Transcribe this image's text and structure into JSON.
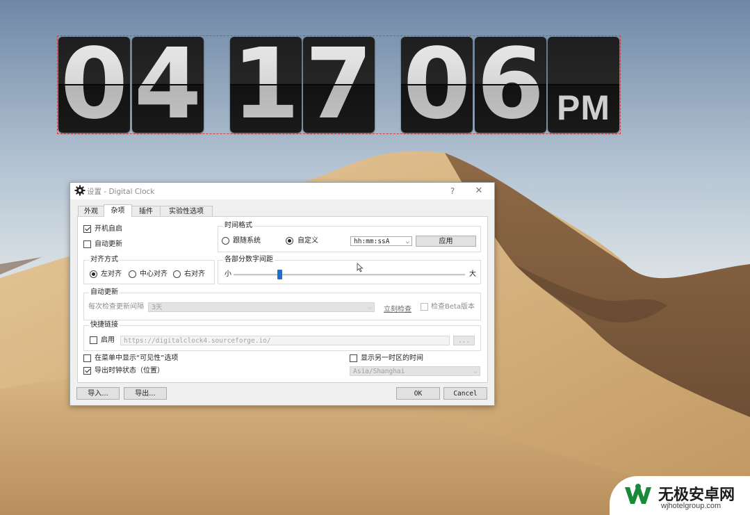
{
  "clock": {
    "digits": [
      "0",
      "4",
      "1",
      "7",
      "0",
      "6"
    ],
    "ampm": "PM"
  },
  "dialog": {
    "title": "设置 - Digital Clock",
    "help": "?",
    "close": "✕",
    "tabs": [
      "外观",
      "杂项",
      "插件",
      "实验性选项"
    ],
    "active_tab": "杂项",
    "autostart": {
      "label": "开机自启",
      "checked": true
    },
    "autoupdate_cb": {
      "label": "自动更新",
      "checked": false
    },
    "time_format": {
      "group": "时间格式",
      "system_label": "跟随系统",
      "custom_label": "自定义",
      "selected": "自定义",
      "format_value": "hh:mm:ssA",
      "apply_label": "应用"
    },
    "alignment": {
      "group": "对齐方式",
      "options": [
        "左对齐",
        "中心对齐",
        "右对齐"
      ],
      "selected": "左对齐"
    },
    "spacing": {
      "group": "各部分数字间距",
      "min_label": "小",
      "max_label": "大",
      "value_fraction": 0.2
    },
    "update": {
      "group": "自动更新",
      "interval_label": "每次检查更新间隔",
      "interval_value": "3天",
      "check_now_label": "立刻检查",
      "beta_label": "检查Beta版本",
      "beta_checked": false
    },
    "shortcut": {
      "group": "快捷链接",
      "enable_label": "启用",
      "enable_checked": false,
      "url": "https://digitalclock4.sourceforge.io/",
      "browse_label": "..."
    },
    "show_visibility": {
      "label": "在菜单中显示“可见性”选项",
      "checked": false
    },
    "export_state": {
      "label": "导出时钟状态（位置）",
      "checked": true
    },
    "other_tz": {
      "label": "显示另一时区的时间",
      "checked": false,
      "value": "Asia/Shanghai"
    },
    "buttons": {
      "import": "导入...",
      "export": "导出...",
      "ok": "OK",
      "cancel": "Cancel"
    }
  },
  "watermark": {
    "title": "无极安卓网",
    "url": "wjhotelgroup.com"
  },
  "colors": {
    "accent": "#1f6fd1",
    "clock_tile": "#1a1a1a",
    "clock_digit": "#d6d6d6"
  }
}
